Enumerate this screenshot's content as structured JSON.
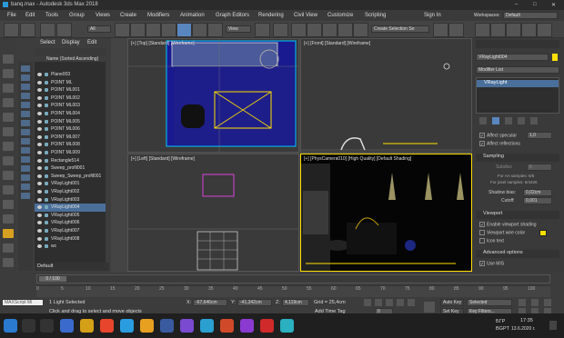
{
  "window": {
    "title": "banq.max - Autodesk 3ds Max 2018",
    "minimize": "–",
    "maximize": "□",
    "close": "✕"
  },
  "menu": [
    "File",
    "Edit",
    "Tools",
    "Group",
    "Views",
    "Create",
    "Modifiers",
    "Animation",
    "Graph Editors",
    "Rendering",
    "Civil View",
    "Customize",
    "Scripting"
  ],
  "account": {
    "sign_in": "Sign In",
    "workspaces_label": "Workspaces:",
    "workspace_value": "Default"
  },
  "toolbar": {
    "filter": "All",
    "view": "View",
    "selection_set": "Create Selection Se"
  },
  "scene_explorer": {
    "tabs": [
      "Select",
      "Display",
      "Edit"
    ],
    "header": "Name (Sorted Ascending)",
    "items": [
      "Plane003",
      "POINT ML",
      "POINT ML001",
      "POINT ML002",
      "POINT ML003",
      "POINT ML004",
      "POINT ML005",
      "POINT ML006",
      "POINT ML007",
      "POINT ML008",
      "POINT ML009",
      "Rectangle514",
      "Sweep_profil001",
      "Sweep_Sweep_profil001",
      "VRayLight001",
      "VRayLight002",
      "VRayLight003",
      "VRayLight004",
      "VRayLight005",
      "VRayLight006",
      "VRayLight007",
      "VRayLight008",
      "wc"
    ],
    "layer": "Default"
  },
  "viewports": {
    "top": "[+] [Top] [Standard] [Wireframe]",
    "front": "[+] [Front] [Standard] [Wireframe]",
    "left": "[+] [Left] [Standard] [Wireframe]",
    "camera": "[+] [PhysCamera010] [High Quality] [Default Shading]"
  },
  "command_panel": {
    "object_name": "VRayLight004",
    "modifier_list": "Modifier List",
    "stack_item": "VRayLight",
    "affect_specular": "Affect specular",
    "affect_specular_value": "1,0",
    "affect_reflections": "Affect reflections",
    "sampling": "Sampling",
    "subdivs": "Subdivs",
    "subdivs_value": "8",
    "note1": "For AA samples: 6/6",
    "note2": "For pixel samples: 6/4426",
    "shadow_bias": "Shadow bias:",
    "shadow_bias_value": "0,02cm",
    "cutoff": "Cutoff:",
    "cutoff_value": "0,001",
    "viewport": "Viewport",
    "enable_viewport_shading": "Enable viewport shading",
    "viewport_wire_color": "Viewport wire color",
    "icon_text": "Icon text",
    "advanced_options": "Advanced options",
    "use_mis": "Use MIS",
    "color_swatch": "#ffe000"
  },
  "timeline": {
    "frame": "0 / 100",
    "ticks": [
      "0",
      "5",
      "10",
      "15",
      "20",
      "25",
      "30",
      "35",
      "40",
      "45",
      "50",
      "55",
      "60",
      "65",
      "70",
      "75",
      "80",
      "85",
      "90",
      "95",
      "100"
    ]
  },
  "status": {
    "maxscript": "MAXScript Mi",
    "selected": "1 Light Selected",
    "prompt": "Click and drag to select and move objects",
    "x_label": "X:",
    "x": "-67,646cm",
    "y_label": "Y:",
    "y": "-41,342cm",
    "z_label": "Z:",
    "z": "4,119cm",
    "grid": "Grid = 25,4cm",
    "add_time_tag": "Add Time Tag",
    "auto_key": "Auto Key",
    "set_key": "Set Key",
    "selected_dropdown": "Selected",
    "key_filters": "Key Filters...",
    "frame_field": "0"
  },
  "taskbar": {
    "lang1": "БГР",
    "lang2": "BGPT",
    "time": "17:35",
    "date": "13.6.2020 г."
  }
}
